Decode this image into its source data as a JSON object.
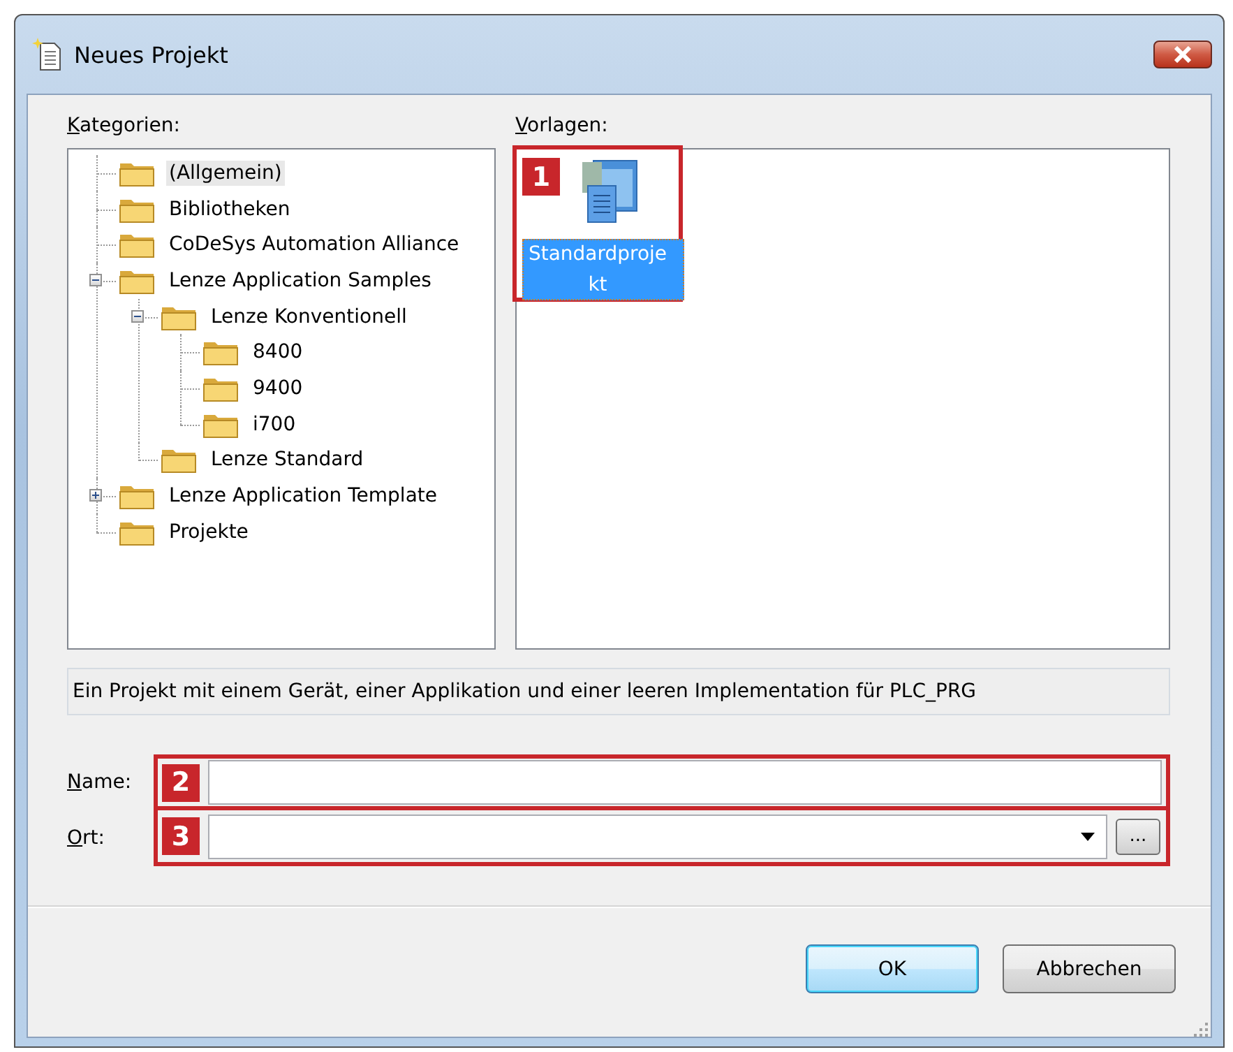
{
  "window": {
    "title": "Neues Projekt"
  },
  "categories": {
    "label": "Kategorien:",
    "items": [
      {
        "label": "(Allgemein)",
        "selected": true
      },
      {
        "label": "Bibliotheken",
        "selected": false
      },
      {
        "label": "CoDeSys Automation Alliance",
        "selected": false
      },
      {
        "label": "Lenze Application Samples",
        "selected": false,
        "expanded": true,
        "children": [
          {
            "label": "Lenze Konventionell",
            "selected": false,
            "expanded": true,
            "children": [
              {
                "label": "8400",
                "selected": false
              },
              {
                "label": "9400",
                "selected": false
              },
              {
                "label": "i700",
                "selected": false
              }
            ]
          },
          {
            "label": "Lenze Standard",
            "selected": false
          }
        ]
      },
      {
        "label": "Lenze Application Template",
        "selected": false,
        "expanded": false
      },
      {
        "label": "Projekte",
        "selected": false
      }
    ]
  },
  "templates": {
    "label": "Vorlagen:",
    "callout": "1",
    "items": [
      {
        "label": "Standardprojekt",
        "selected": true
      }
    ]
  },
  "description": "Ein Projekt mit einem Gerät, einer Applikation und einer leeren Implementation für PLC_PRG",
  "name_field": {
    "label": "Name:",
    "callout": "2"
  },
  "location_field": {
    "label": "Ort:",
    "callout": "3",
    "browse": "..."
  },
  "buttons": [
    {
      "label": "OK",
      "default": true
    },
    {
      "label": "Abbrechen",
      "default": false
    }
  ]
}
